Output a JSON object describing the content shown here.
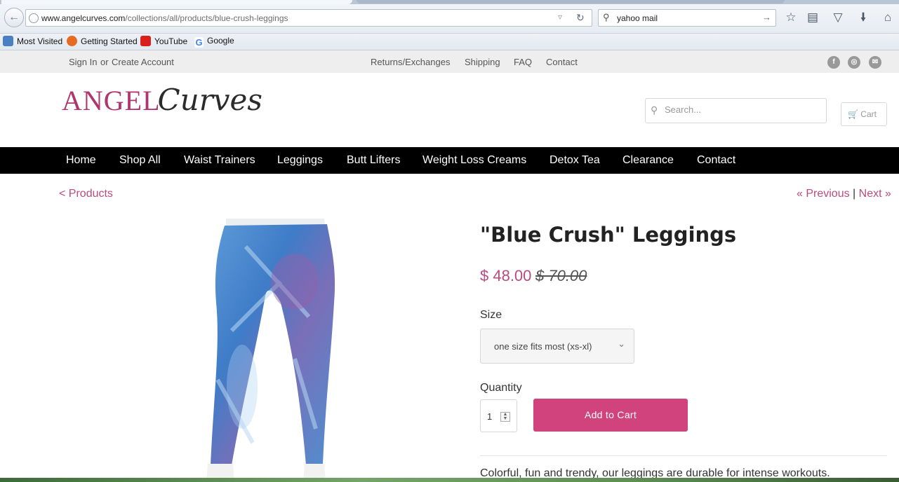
{
  "browser": {
    "url_domain": "www.angelcurves.com",
    "url_path": "/collections/all/products/blue-crush-leggings",
    "search_text": "yahoo mail",
    "bookmarks": [
      {
        "label": "Most Visited",
        "icon": "most-visited-icon",
        "color": "#4a7fc1"
      },
      {
        "label": "Getting Started",
        "icon": "firefox-icon",
        "color": "#e66a1f"
      },
      {
        "label": "YouTube",
        "icon": "youtube-icon",
        "color": "#d9201c"
      },
      {
        "label": "Google",
        "icon": "google-icon",
        "color": "#4285f4"
      }
    ]
  },
  "utility": {
    "sign_in": "Sign In",
    "or": "or",
    "create_account": "Create Account",
    "links": [
      "Returns/Exchanges",
      "Shipping",
      "FAQ",
      "Contact"
    ],
    "social_icons": [
      "facebook-icon",
      "instagram-icon",
      "email-icon"
    ]
  },
  "header": {
    "logo_angel": "ANGEL",
    "logo_curves": "Curves",
    "search_placeholder": "Search...",
    "cart_label": "Cart"
  },
  "main_nav": [
    "Home",
    "Shop All",
    "Waist Trainers",
    "Leggings",
    "Butt Lifters",
    "Weight Loss Creams",
    "Detox Tea",
    "Clearance",
    "Contact"
  ],
  "breadcrumb": "< Products",
  "pager": {
    "previous": "« Previous",
    "separator": "|",
    "next": "Next »"
  },
  "product": {
    "title": "\"Blue Crush\" Leggings",
    "price": "$ 48.00",
    "compare_price": "$ 70.00",
    "size_label": "Size",
    "size_value": "one size fits most (xs-xl)",
    "quantity_label": "Quantity",
    "quantity_value": "1",
    "add_to_cart": "Add to Cart",
    "description": "Colorful, fun and trendy, our leggings are durable for intense workouts."
  },
  "colors": {
    "brand": "#b84b80",
    "button": "#d0437d",
    "nav_bg": "#000000"
  }
}
